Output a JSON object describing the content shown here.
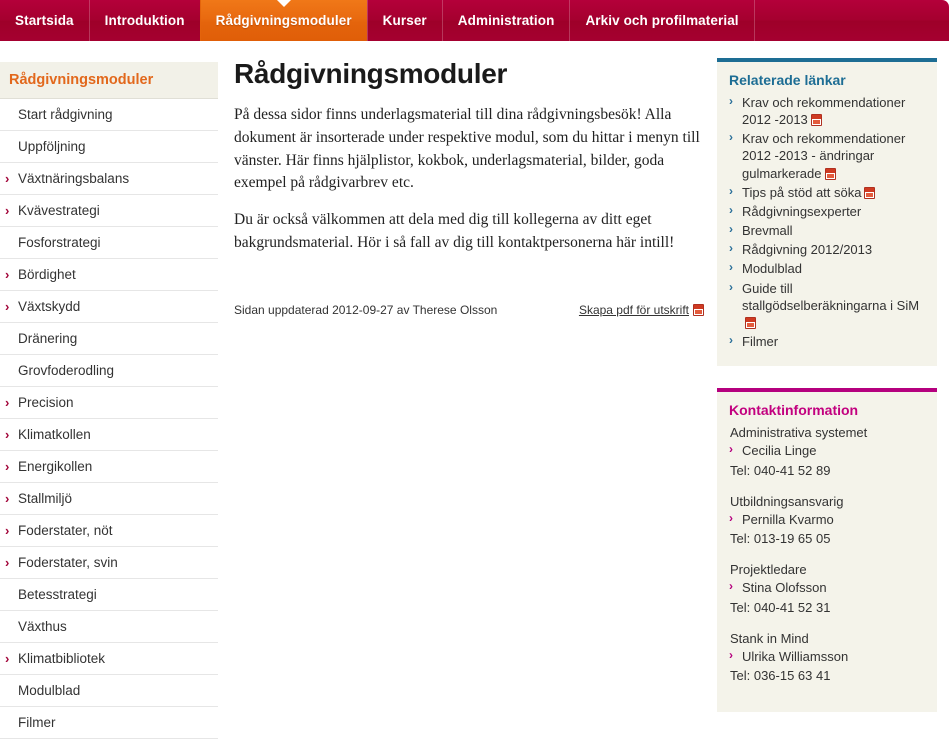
{
  "nav": {
    "items": [
      {
        "label": "Startsida",
        "active": false
      },
      {
        "label": "Introduktion",
        "active": false
      },
      {
        "label": "Rådgivningsmoduler",
        "active": true
      },
      {
        "label": "Kurser",
        "active": false
      },
      {
        "label": "Administration",
        "active": false
      },
      {
        "label": "Arkiv och profilmaterial",
        "active": false
      }
    ]
  },
  "sidebar": {
    "header": "Rådgivningsmoduler",
    "items": [
      {
        "label": "Start rådgivning",
        "expandable": false
      },
      {
        "label": "Uppföljning",
        "expandable": false
      },
      {
        "label": "Växtnäringsbalans",
        "expandable": true
      },
      {
        "label": "Kvävestrategi",
        "expandable": true
      },
      {
        "label": "Fosforstrategi",
        "expandable": false
      },
      {
        "label": "Bördighet",
        "expandable": true
      },
      {
        "label": "Växtskydd",
        "expandable": true
      },
      {
        "label": "Dränering",
        "expandable": false
      },
      {
        "label": "Grovfoderodling",
        "expandable": false
      },
      {
        "label": "Precision",
        "expandable": true
      },
      {
        "label": "Klimatkollen",
        "expandable": true
      },
      {
        "label": "Energikollen",
        "expandable": true
      },
      {
        "label": "Stallmiljö",
        "expandable": true
      },
      {
        "label": "Foderstater, nöt",
        "expandable": true
      },
      {
        "label": "Foderstater, svin",
        "expandable": true
      },
      {
        "label": "Betesstrategi",
        "expandable": false
      },
      {
        "label": "Växthus",
        "expandable": false
      },
      {
        "label": "Klimatbibliotek",
        "expandable": true
      },
      {
        "label": "Modulblad",
        "expandable": false
      },
      {
        "label": "Filmer",
        "expandable": false
      }
    ]
  },
  "main": {
    "title": "Rådgivningsmoduler",
    "paragraphs": [
      "På dessa sidor finns underlagsmaterial till dina rådgivningsbesök! Alla dokument är insorterade under respektive modul, som du hittar i menyn till vänster. Här finns hjälplistor, kokbok, underlagsmaterial, bilder, goda exempel på rådgivarbrev etc.",
      "Du är också välkommen att dela med dig till kollegerna av ditt eget bakgrundsmaterial. Hör i så fall av dig till kontaktpersonerna här intill!"
    ],
    "updated": "Sidan uppdaterad 2012-09-27 av Therese Olsson",
    "pdf_link": "Skapa pdf för utskrift"
  },
  "related": {
    "title": "Relaterade länkar",
    "links": [
      {
        "label": "Krav och rekommendationer 2012 -2013",
        "pdf": true
      },
      {
        "label": "Krav och rekommendationer 2012 -2013 - ändringar gulmarkerade",
        "pdf": true
      },
      {
        "label": "Tips på stöd att söka",
        "pdf": true
      },
      {
        "label": "Rådgivningsexperter",
        "pdf": false
      },
      {
        "label": "Brevmall",
        "pdf": false
      },
      {
        "label": "Rådgivning 2012/2013",
        "pdf": false
      },
      {
        "label": "Modulblad",
        "pdf": false
      },
      {
        "label": "Guide till stallgödselberäkningarna i SiM",
        "pdf": true
      },
      {
        "label": "Filmer",
        "pdf": false
      }
    ]
  },
  "contact": {
    "title": "Kontaktinformation",
    "groups": [
      {
        "role": "Administrativa systemet",
        "name": "Cecilia Linge",
        "tel": "Tel: 040-41 52 89"
      },
      {
        "role": "Utbildningsansvarig",
        "name": "Pernilla Kvarmo",
        "tel": "Tel: 013-19 65 05"
      },
      {
        "role": "Projektledare",
        "name": "Stina Olofsson",
        "tel": "Tel: 040-41 52 31"
      },
      {
        "role": "Stank in Mind",
        "name": "Ulrika Williamsson",
        "tel": "Tel: 036-15 63 41"
      }
    ]
  },
  "icons": {
    "chevron": "›",
    "pdf": "pdf-icon"
  },
  "colors": {
    "nav_bg": "#a5002f",
    "nav_active": "#e4640c",
    "sidebar_head_text": "#e2681c",
    "related_accent": "#1d6d94",
    "contact_accent": "#b5007e",
    "panel_bg": "#f4f3ea"
  }
}
